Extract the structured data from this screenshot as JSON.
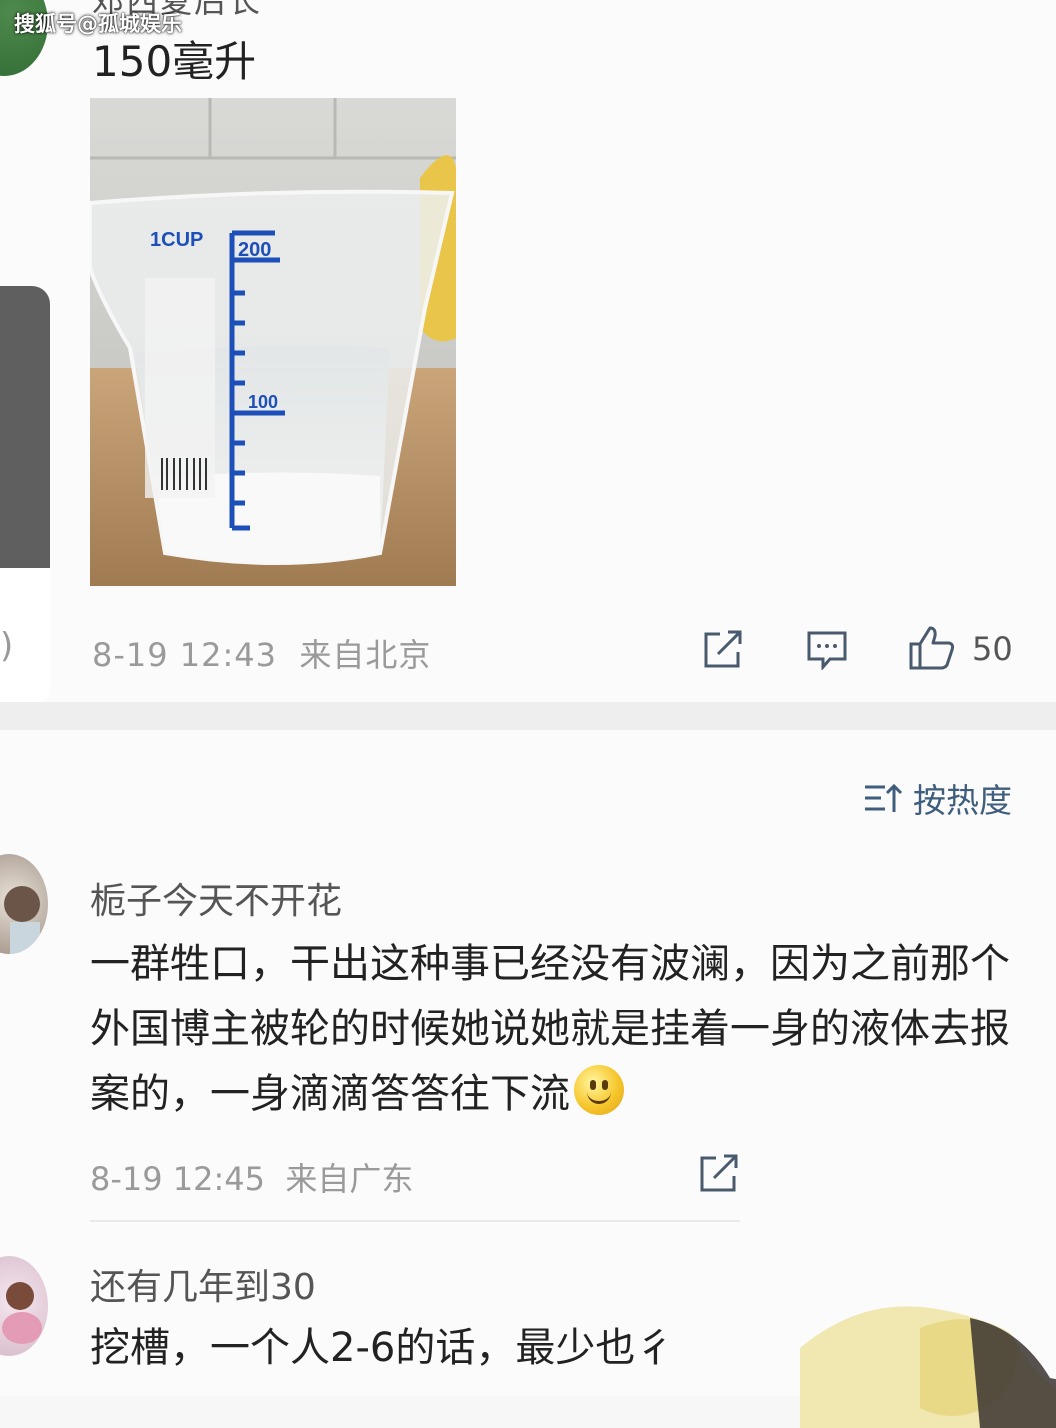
{
  "watermark": "搜狐号@孤城娱乐",
  "post": {
    "author_partial": "邓西夏后长",
    "text": "150毫升",
    "photo_labels": {
      "cup": "1CUP",
      "mark_top": "200",
      "mark_mid": "100"
    },
    "time": "8-19 12:43",
    "location": "来自北京",
    "like_count": "50"
  },
  "side_panel": {
    "glyph": ")"
  },
  "comments": {
    "sort_label": "按热度",
    "items": [
      {
        "name": "栀子今天不开花",
        "text": "一群牲口，干出这种事已经没有波澜，因为之前那个外国博主被轮的时候她说她就是挂着一身的液体去报案的，一身滴滴答答往下流",
        "time": "8-19 12:45",
        "location": "来自广东"
      },
      {
        "name": "还有几年到30",
        "text": "挖槽，一个人2-6的话，最少也彳"
      }
    ]
  },
  "colors": {
    "accent": "#3f5d7d",
    "meta": "#9a9a9a",
    "icon": "#4a5a6e",
    "cup_ink": "#1d4fb8"
  },
  "icons": [
    "share-icon",
    "comment-icon",
    "like-icon",
    "sort-icon",
    "smiley-emoji"
  ]
}
